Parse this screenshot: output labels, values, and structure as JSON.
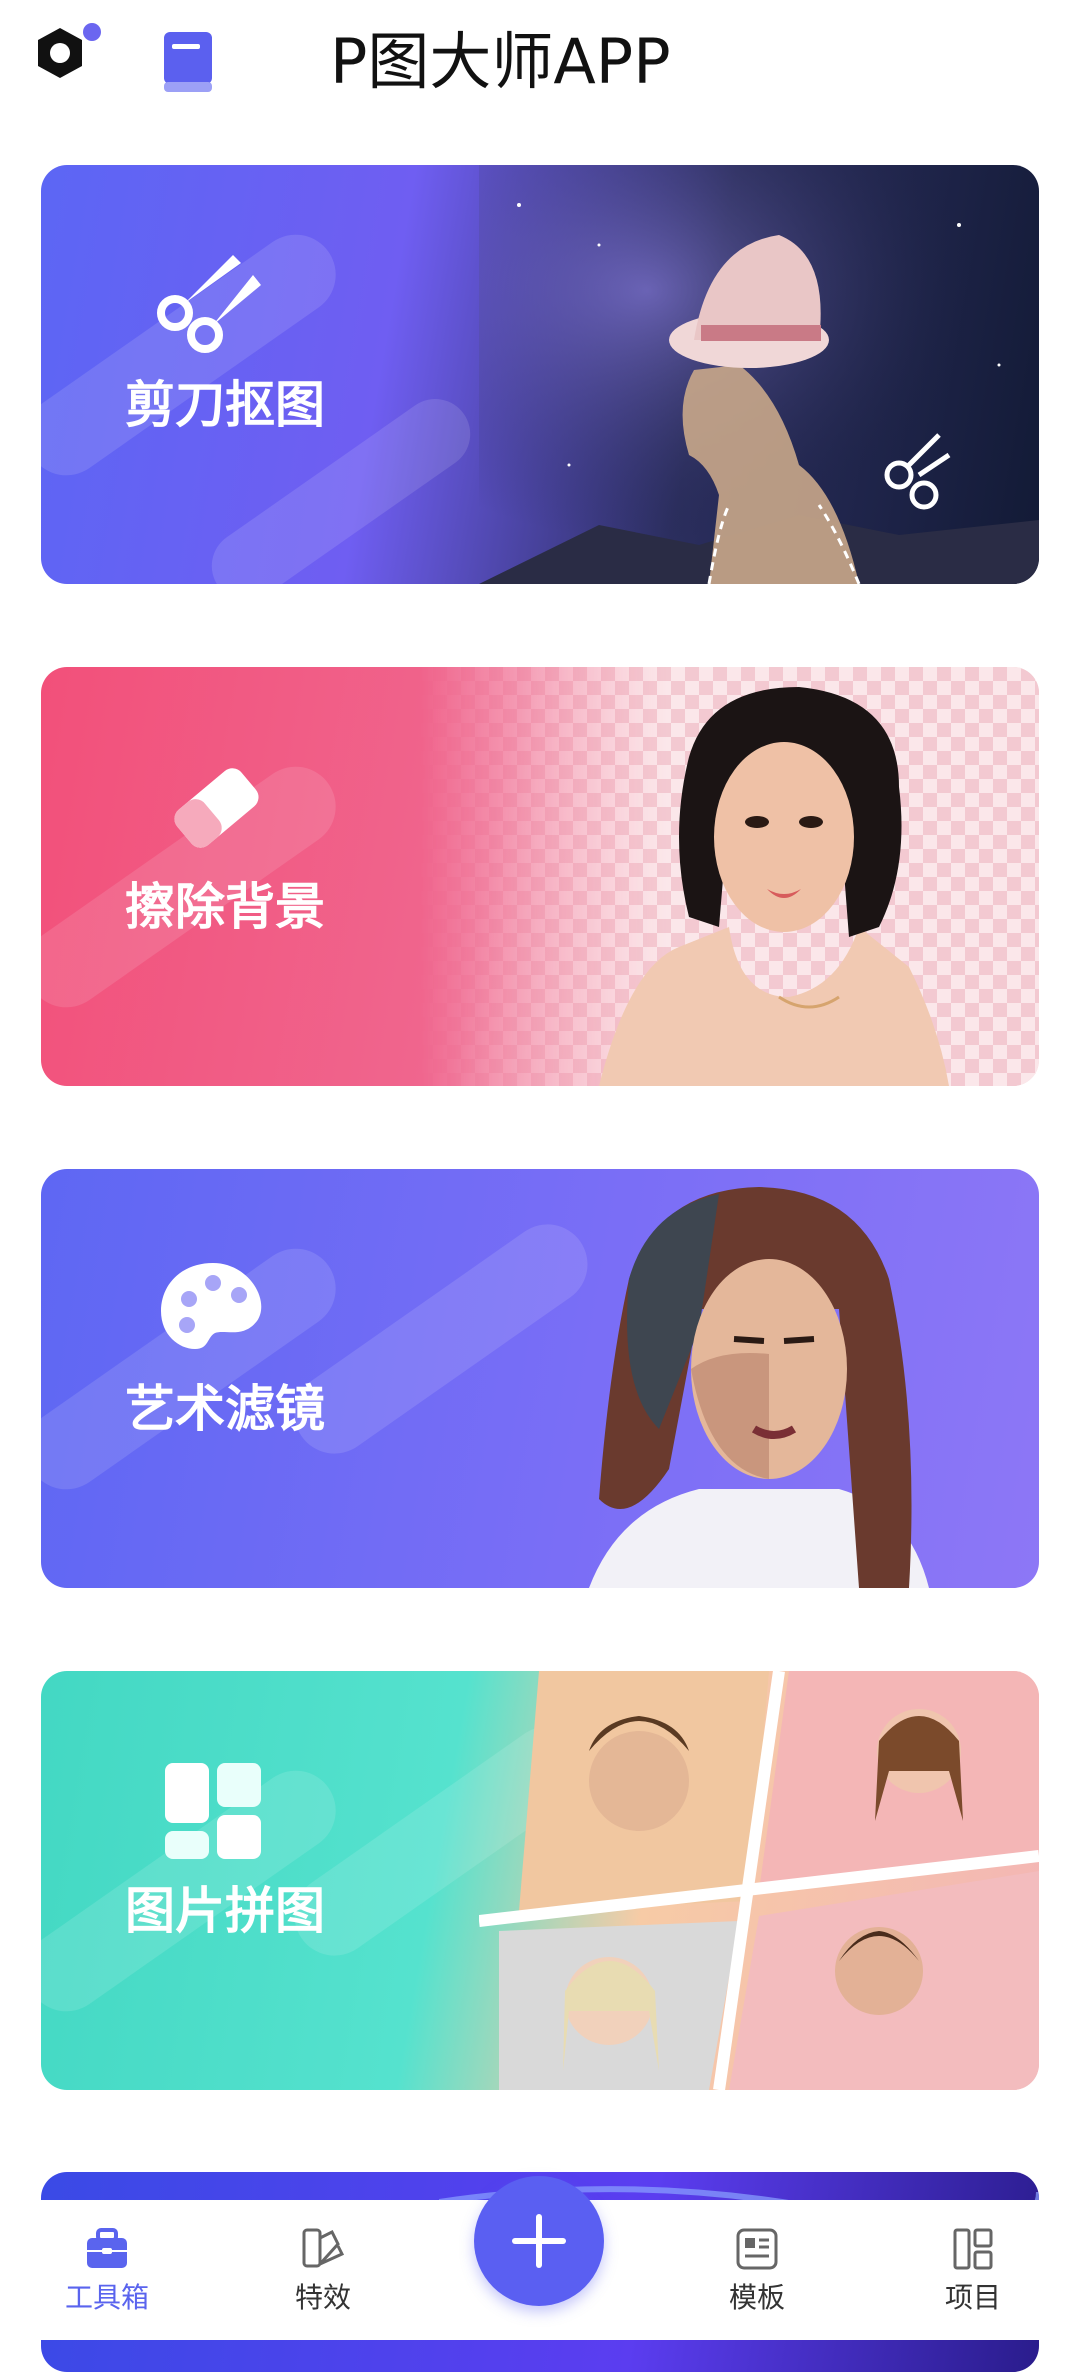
{
  "header": {
    "title": "P图大师APP"
  },
  "cards": [
    {
      "title": "剪刀抠图",
      "icon": "scissors-icon"
    },
    {
      "title": "擦除背景",
      "icon": "eraser-icon"
    },
    {
      "title": "艺术滤镜",
      "icon": "palette-icon"
    },
    {
      "title": "图片拼图",
      "icon": "collage-icon"
    }
  ],
  "nav": {
    "items": [
      {
        "label": "工具箱",
        "icon": "toolbox-icon",
        "active": true
      },
      {
        "label": "特效",
        "icon": "effects-icon"
      },
      {
        "label": "模板",
        "icon": "template-icon"
      },
      {
        "label": "项目",
        "icon": "project-icon"
      }
    ],
    "add_icon": "plus-icon"
  },
  "colors": {
    "accent": "#5a5ff2",
    "active_label": "#5a64ee"
  }
}
